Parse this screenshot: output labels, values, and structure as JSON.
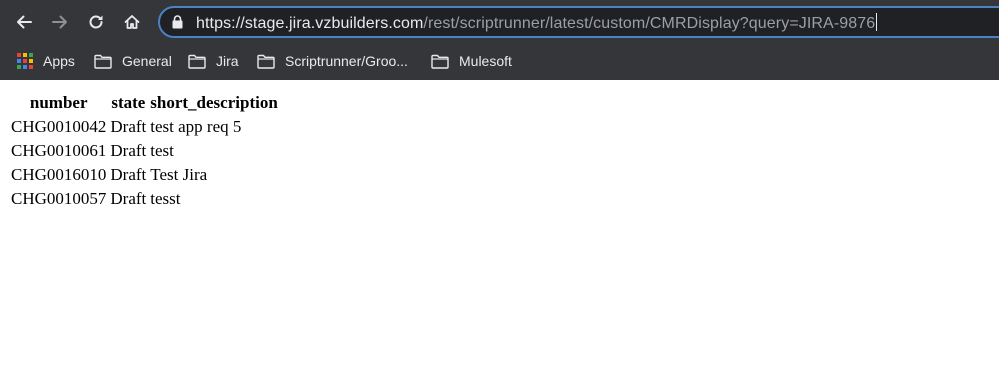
{
  "browser": {
    "url_host": "https://stage.jira.vzbuilders.com",
    "url_path": "/rest/scriptrunner/latest/custom/CMRDisplay?query=JIRA-9876"
  },
  "bookmarks": [
    {
      "label": "Apps",
      "icon": "apps-grid-icon"
    },
    {
      "label": "General",
      "icon": "folder-icon"
    },
    {
      "label": "Jira",
      "icon": "folder-icon"
    },
    {
      "label": "Scriptrunner/Groo...",
      "icon": "folder-icon"
    },
    {
      "label": "Mulesoft",
      "icon": "folder-icon"
    }
  ],
  "table": {
    "headers": [
      "number",
      "state",
      "short_description"
    ],
    "rows": [
      [
        "CHG0010042",
        "Draft",
        "test app req 5"
      ],
      [
        "CHG0010061",
        "Draft",
        "test"
      ],
      [
        "CHG0016010",
        "Draft",
        "Test Jira"
      ],
      [
        "CHG0010057",
        "Draft",
        "tesst"
      ]
    ]
  },
  "colors": {
    "chrome_bg": "#35363a",
    "omnibox_bg": "#202124",
    "focus_ring": "#4a82c4"
  }
}
